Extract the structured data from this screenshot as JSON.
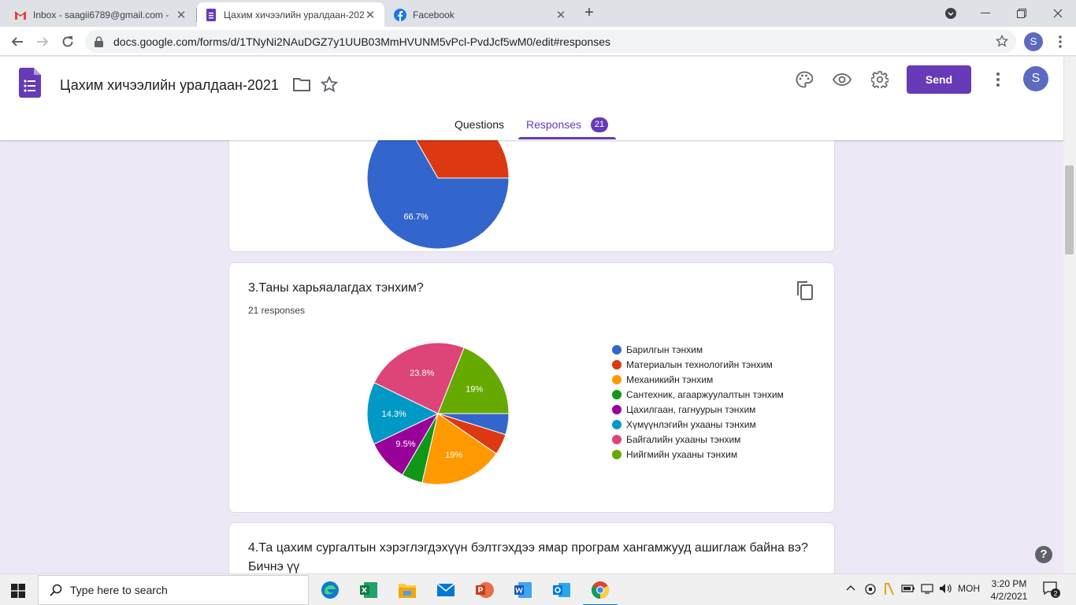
{
  "browser": {
    "tabs": [
      {
        "title": "Inbox - saagii6789@gmail.com -",
        "icon": "gmail-icon"
      },
      {
        "title": "Цахим хичээлийн уралдаан-2021",
        "icon": "google-forms-icon"
      },
      {
        "title": "Facebook",
        "icon": "facebook-icon"
      }
    ],
    "url": "docs.google.com/forms/d/1TNyNi2NAuDGZ7y1UUB03MmHVUNM5vPcl-PvdJcf5wM0/edit#responses",
    "profile_initial": "S"
  },
  "form": {
    "title": "Цахим хичээлийн уралдаан-2021",
    "send_label": "Send",
    "avatar_initial": "S",
    "tab_questions": "Questions",
    "tab_responses": "Responses",
    "responses_count": "21",
    "accent": "#673ab7"
  },
  "questions": [
    {
      "title": "3.Таны харьяалагдах тэнхим?",
      "responses": "21 responses"
    },
    {
      "title": "4.Та цахим сургалтын хэрэглэгдэхүүн бэлтгэхдээ ямар програм хангамжууд ашиглаж байна вэ? Бичнэ үү"
    }
  ],
  "chart_data": [
    {
      "type": "pie",
      "note_visible": "partial chart cut off at top of viewport",
      "slices": [
        {
          "value": 66.7,
          "label": "66.7%",
          "color": "#3366cc"
        },
        {
          "value": 33.3,
          "label": "",
          "color": "#dc3912"
        }
      ]
    },
    {
      "type": "pie",
      "slices": [
        {
          "name": "Барилгын тэнхим",
          "value": 4.8,
          "label": "",
          "color": "#3366cc"
        },
        {
          "name": "Материалын технологийн тэнхим",
          "value": 4.8,
          "label": "",
          "color": "#dc3912"
        },
        {
          "name": "Механикийн тэнхим",
          "value": 19,
          "label": "19%",
          "color": "#ff9900"
        },
        {
          "name": "Сантехник, агааржуулалтын тэнхим",
          "value": 4.8,
          "label": "",
          "color": "#109618"
        },
        {
          "name": "Цахилгаан, гагнуурын тэнхим",
          "value": 9.5,
          "label": "9.5%",
          "color": "#990099"
        },
        {
          "name": "Хүмүүнлэгийн ухааны тэнхим",
          "value": 14.3,
          "label": "14.3%",
          "color": "#0099c6"
        },
        {
          "name": "Байгалийн ухааны тэнхим",
          "value": 23.8,
          "label": "23.8%",
          "color": "#dd4477"
        },
        {
          "name": "Нийгмийн ухааны тэнхим",
          "value": 19,
          "label": "19%",
          "color": "#66aa00"
        }
      ],
      "legend": "right"
    }
  ],
  "taskbar": {
    "search_placeholder": "Type here to search",
    "language": "МОН",
    "time": "3:20 PM",
    "date": "4/2/2021",
    "notifications": "2",
    "apps": [
      "edge-icon",
      "excel-icon",
      "file-explorer-icon",
      "mail-icon",
      "powerpoint-icon",
      "word-icon",
      "outlook-icon",
      "chrome-icon"
    ]
  }
}
